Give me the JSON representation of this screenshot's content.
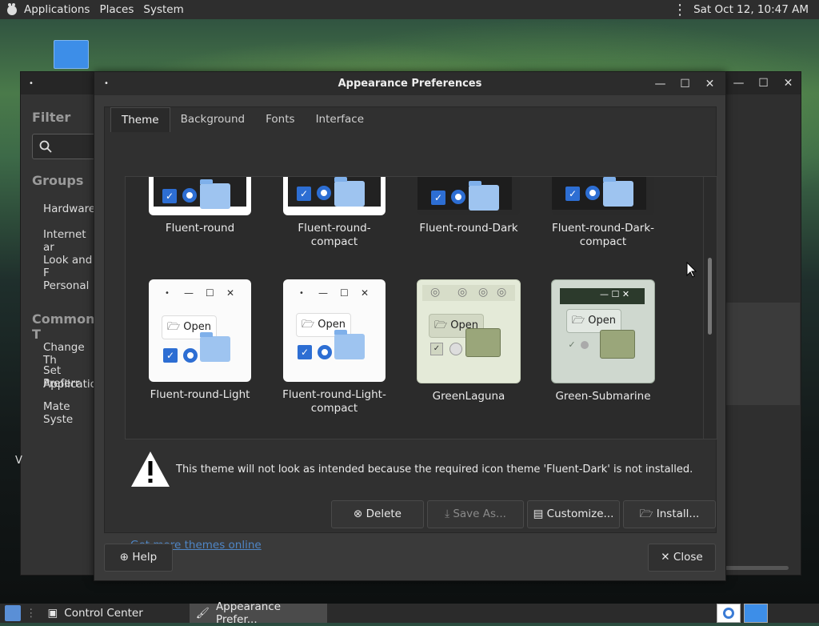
{
  "topbar": {
    "menus": [
      "Applications",
      "Places",
      "System"
    ],
    "clock": "Sat Oct 12, 10:47 AM",
    "icons": [
      "gnome-foot-icon",
      "vertical-dots-icon"
    ]
  },
  "control_center": {
    "filter_label": "Filter",
    "groups_label": "Groups",
    "groups": [
      "Hardware",
      "Internet ar",
      "Look and F",
      "Personal"
    ],
    "common_label": "Common T",
    "common": [
      "Change Th",
      "Set Preferr",
      "Application",
      "Mate Syste"
    ],
    "left_letter": "V"
  },
  "dialog": {
    "title": "Appearance Preferences",
    "tabs": [
      "Theme",
      "Background",
      "Fonts",
      "Interface"
    ],
    "active_tab": "Theme",
    "themes_row1": [
      "Fluent-round",
      "Fluent-round-\ncompact",
      "Fluent-round-Dark",
      "Fluent-round-Dark-\ncompact"
    ],
    "themes_row2": [
      "Fluent-round-Light",
      "Fluent-round-Light-\ncompact",
      "GreenLaguna",
      "Green-Submarine"
    ],
    "preview_open_label": "Open",
    "warning": "This theme will not look as intended because the required icon theme 'Fluent-Dark' is not installed.",
    "buttons": {
      "delete": "Delete",
      "save_as": "Save As...",
      "customize": "Customize...",
      "install": "Install..."
    },
    "link": "Get more themes online",
    "help": "Help",
    "close": "Close"
  },
  "taskbar": {
    "items": [
      "Control Center",
      "Appearance Prefer..."
    ]
  }
}
